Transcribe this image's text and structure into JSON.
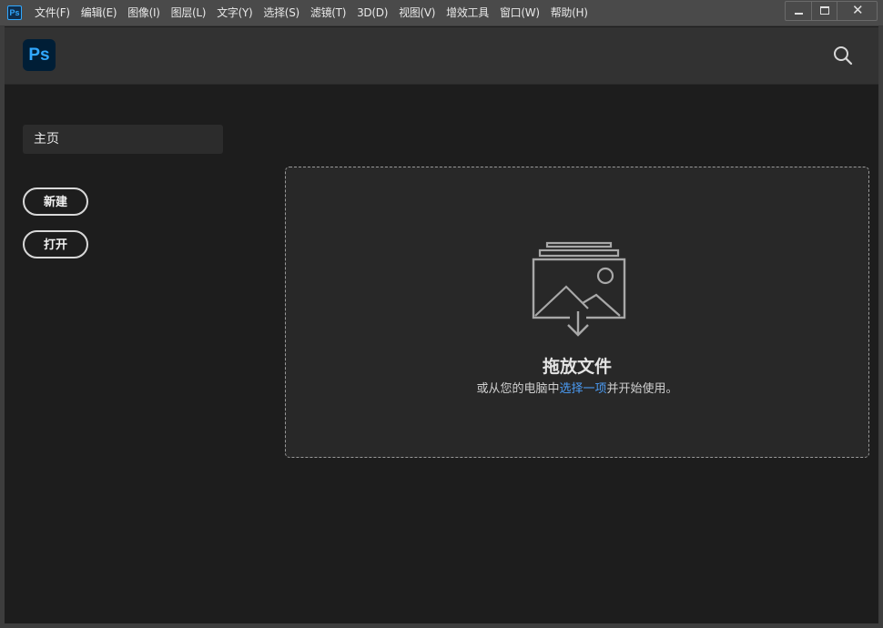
{
  "titlebar": {
    "app_icon_text": "Ps",
    "menu": [
      "文件(F)",
      "编辑(E)",
      "图像(I)",
      "图层(L)",
      "文字(Y)",
      "选择(S)",
      "滤镜(T)",
      "3D(D)",
      "视图(V)",
      "增效工具",
      "窗口(W)",
      "帮助(H)"
    ],
    "close_glyph": "✕"
  },
  "header": {
    "logo_text": "Ps",
    "search_icon": "search-icon"
  },
  "sidebar": {
    "home_label": "主页",
    "new_label": "新建",
    "open_label": "打开"
  },
  "dropzone": {
    "title": "拖放文件",
    "subtitle_before": "或从您的电脑中",
    "subtitle_link": "选择一项",
    "subtitle_after": "并开始使用。",
    "icon": "image-drop-icon"
  },
  "colors": {
    "accent_blue": "#31a8ff",
    "link_blue": "#4b9cf5",
    "background": "#1d1d1d",
    "header": "#323232"
  }
}
